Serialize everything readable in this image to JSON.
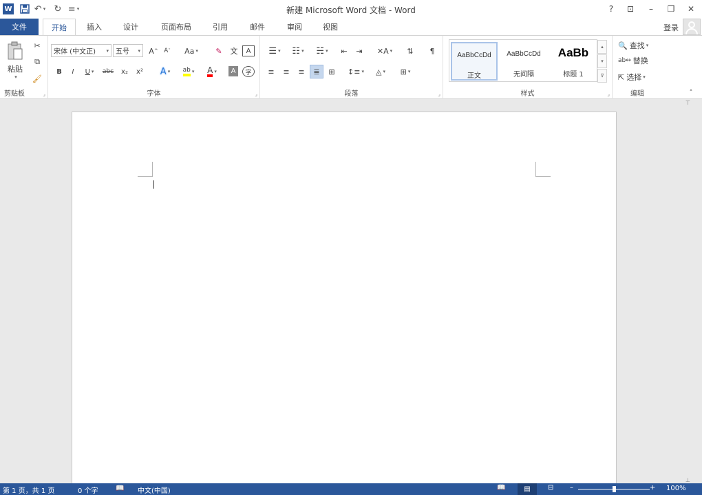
{
  "window": {
    "title": "新建 Microsoft Word 文档 - Word",
    "controls": {
      "help": "?",
      "ribbon_display": "⊡",
      "minimize": "–",
      "restore": "❐",
      "close": "✕"
    }
  },
  "qat": {
    "app_icon": "W",
    "save": "💾",
    "undo": "↶",
    "redo": "↻",
    "customize": "≡"
  },
  "tabs": {
    "file": "文件",
    "items": [
      "开始",
      "插入",
      "设计",
      "页面布局",
      "引用",
      "邮件",
      "审阅",
      "视图"
    ],
    "active": "开始"
  },
  "account": {
    "sign_in": "登录"
  },
  "ribbon": {
    "clipboard": {
      "label": "剪贴板",
      "paste": "粘贴"
    },
    "font": {
      "label": "字体",
      "font_name": "宋体 (中文正)",
      "font_size": "五号",
      "grow": "A",
      "shrink": "A",
      "change_case": "Aa",
      "bold": "B",
      "italic": "I",
      "underline": "U",
      "strike": "abc",
      "subscript": "x₂",
      "superscript": "x²",
      "text_effects": "A",
      "highlight": "ab",
      "font_color": "A",
      "char_shading": "A",
      "enclose": "字"
    },
    "paragraph": {
      "label": "段落"
    },
    "styles": {
      "label": "样式",
      "items": [
        {
          "sample": "AaBbCcDd",
          "name": "正文"
        },
        {
          "sample": "AaBbCcDd",
          "name": "无间隔"
        },
        {
          "sample": "AaBb",
          "name": "标题 1"
        }
      ]
    },
    "editing": {
      "label": "编辑",
      "find": "查找",
      "replace": "替换",
      "select": "选择"
    }
  },
  "status": {
    "page": "第 1 页，共 1 页",
    "words": "0 个字",
    "language": "中文(中国)",
    "zoom": "100%",
    "zoom_fraction": 0.5
  },
  "colors": {
    "accent": "#2b579a",
    "highlight": "#ffff00",
    "font_color": "#ff0000"
  }
}
